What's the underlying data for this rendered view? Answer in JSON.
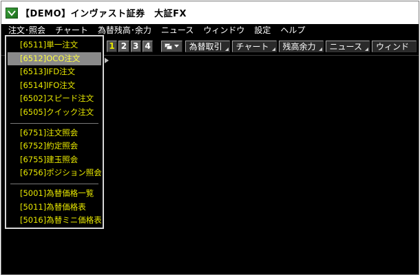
{
  "window": {
    "title": "【DEMO】インヴァスト証券　大証FX"
  },
  "menubar": {
    "items": [
      {
        "label": "注文･照会"
      },
      {
        "label": "チャート"
      },
      {
        "label": "為替残高･余力"
      },
      {
        "label": "ニュース"
      },
      {
        "label": "ウィンドウ"
      },
      {
        "label": "設定"
      },
      {
        "label": "ヘルプ"
      }
    ]
  },
  "toolbar": {
    "number_buttons": [
      "1",
      "2",
      "3",
      "4"
    ],
    "active_number": "1",
    "buttons": [
      {
        "label": "為替取引"
      },
      {
        "label": "チャート"
      },
      {
        "label": "残高余力"
      },
      {
        "label": "ニュース"
      },
      {
        "label": "ウィンド"
      }
    ]
  },
  "dropdown": {
    "groups": [
      [
        {
          "label": "[6511]単一注文",
          "selected": false
        },
        {
          "label": "[6512]OCO注文",
          "selected": true
        },
        {
          "label": "[6513]IFD注文",
          "selected": false
        },
        {
          "label": "[6514]IFO注文",
          "selected": false
        },
        {
          "label": "[6502]スピード注文",
          "selected": false
        },
        {
          "label": "[6505]クイック注文",
          "selected": false
        }
      ],
      [
        {
          "label": "[6751]注文照会",
          "selected": false
        },
        {
          "label": "[6752]約定照会",
          "selected": false
        },
        {
          "label": "[6755]建玉照会",
          "selected": false
        },
        {
          "label": "[6756]ポジション照会",
          "selected": false
        }
      ],
      [
        {
          "label": "[5001]為替価格一覧",
          "selected": false
        },
        {
          "label": "[5011]為替価格表",
          "selected": false
        },
        {
          "label": "[5016]為替ミニ価格表",
          "selected": false
        }
      ]
    ]
  },
  "colors": {
    "menu_text": "#e8e800",
    "selected_bg": "#8a8a8a",
    "background": "#000000"
  }
}
